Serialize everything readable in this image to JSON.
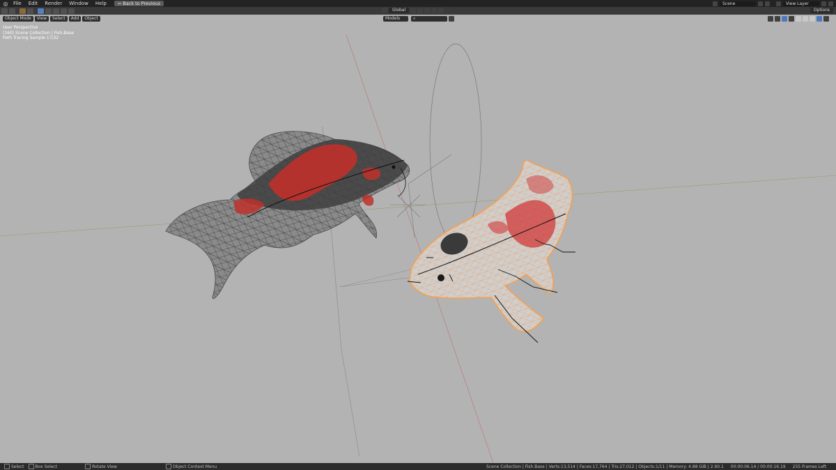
{
  "topbar": {
    "menus": [
      "File",
      "Edit",
      "Render",
      "Window",
      "Help"
    ],
    "back_label": "Back to Previous",
    "scene": "Scene",
    "view_layer": "View Layer"
  },
  "header2": {
    "transform_orientation": "Global",
    "options": "Options"
  },
  "viewport_header": {
    "mode": "Object Mode",
    "menus": [
      "View",
      "Select",
      "Add",
      "Object"
    ],
    "collection": "Models"
  },
  "overlay": {
    "view": "User Perspective",
    "collection": "(160) Scene Collection | Fish.Base",
    "sample": "Path Tracing Sample 17/32"
  },
  "statusbar": {
    "left": [
      "Select",
      "Box Select",
      "Rotate View",
      "Object Context Menu"
    ],
    "right": {
      "stats": "Scene Collection | Fish.Base | Verts:13,514 | Faces:17,764 | Tris:27,012 | Objects:1/11 | Memory: 4.88 GiB | 2.90.1",
      "time": "00:00:06.14 / 00:00:16.19",
      "frames": "255 Frames Left"
    }
  },
  "colors": {
    "viewport_bg": "#b3b3b3",
    "selection_outline": "#f5a050",
    "koi_red": "#c0302a"
  }
}
